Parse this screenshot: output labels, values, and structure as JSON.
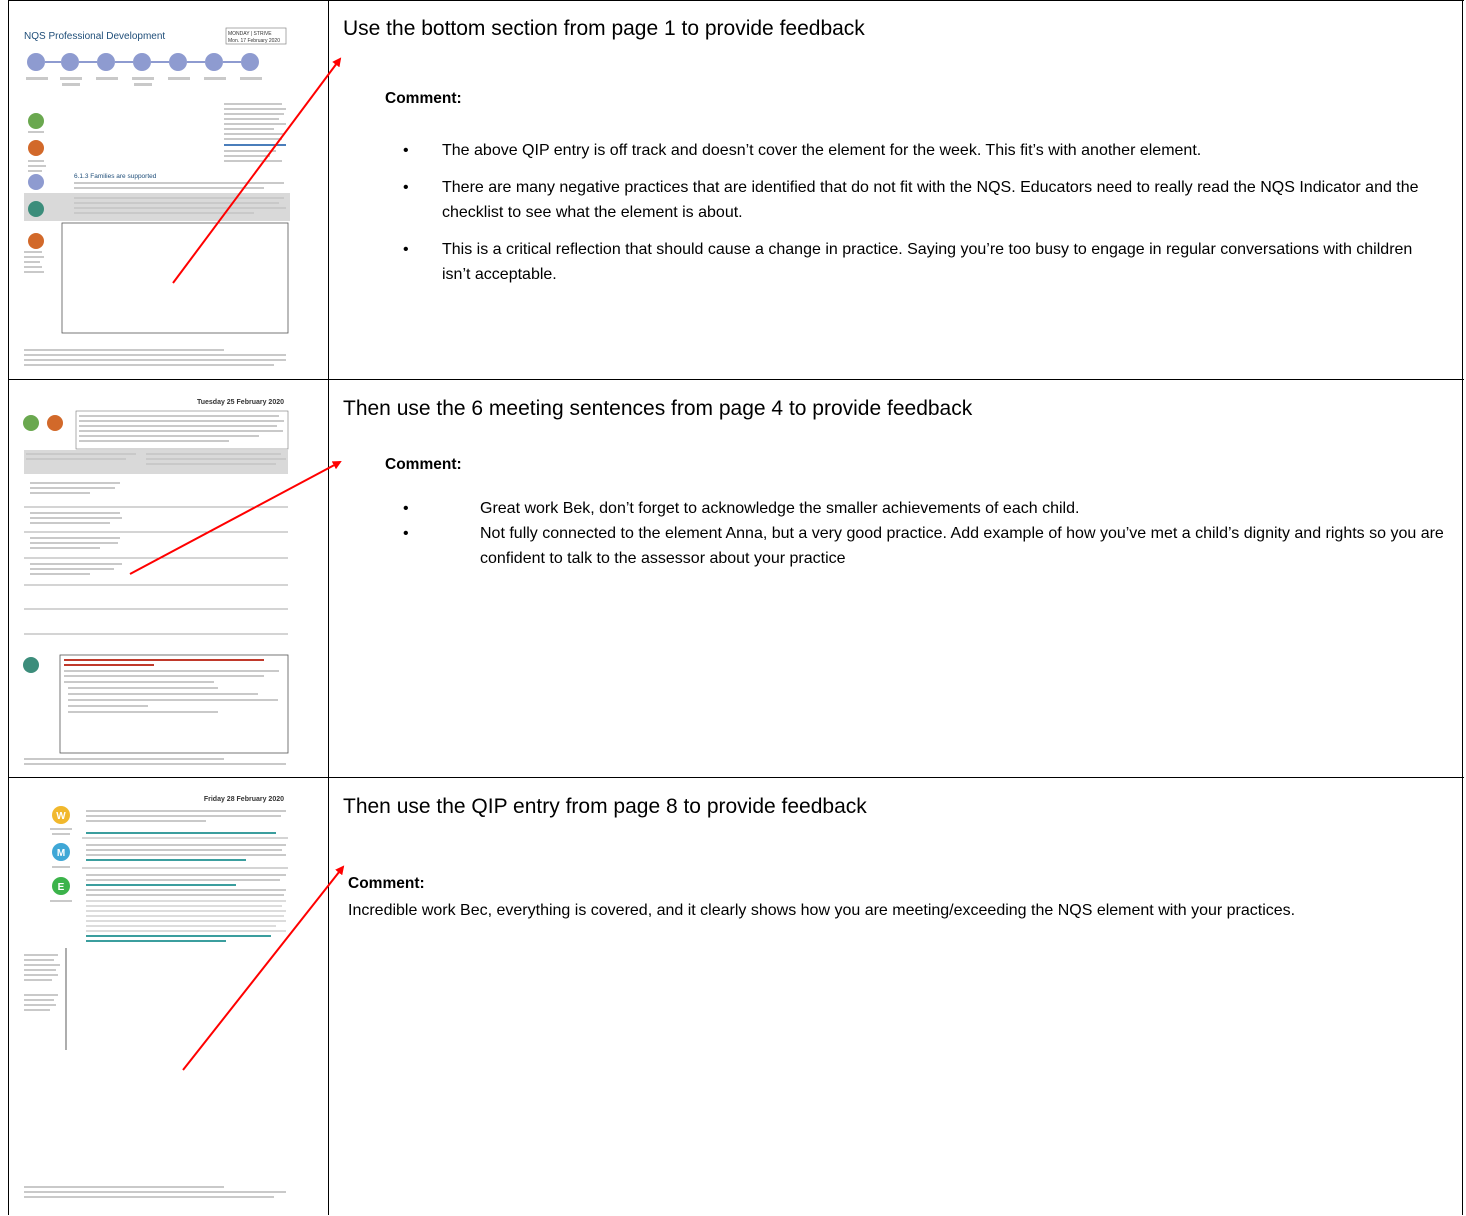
{
  "rows": [
    {
      "thumbnail": {
        "title": "NQS Professional Development",
        "date_line1": "MONDAY | STRIVE",
        "date_line2": "Mon. 17 February 2020",
        "heading": "6.1.3 Families are supported",
        "icon_colors": [
          "#6aa84f",
          "#d2692a",
          "#8e9bd0",
          "#3c8d7b",
          "#d2692a"
        ]
      },
      "heading": "Use the bottom section from page 1 to provide feedback",
      "comment_label": "Comment:",
      "bullets": [
        "The above QIP entry is off track and doesn’t cover the element for the week. This fit’s with another element.",
        "There are many negative practices that are identified that do not fit with the NQS. Educators need to really read the NQS Indicator and the checklist to see what the element is about.",
        "This is a critical reflection that should cause a change in practice. Saying you’re too busy to engage in regular conversations with children isn’t acceptable."
      ]
    },
    {
      "thumbnail": {
        "date": "Tuesday 25 February 2020"
      },
      "heading": "Then use the 6 meeting sentences from page 4 to provide feedback",
      "comment_label": "Comment:",
      "bullets": [
        "Great work Bek, don’t forget to acknowledge the smaller achievements of each child.",
        "Not fully connected to the element Anna, but a very good practice. Add example of how you’ve met a child’s dignity and rights so you are confident to talk to the assessor about your practice"
      ]
    },
    {
      "thumbnail": {
        "date": "Friday 28 February 2020",
        "badges": [
          {
            "letter": "W",
            "color": "#f1b82d"
          },
          {
            "letter": "M",
            "color": "#3fa7d6"
          },
          {
            "letter": "E",
            "color": "#3bb34a"
          }
        ]
      },
      "heading": "Then use the QIP entry from page 8 to provide feedback",
      "comment_label": "Comment:",
      "paragraph": "Incredible work Bec, everything is covered, and it clearly shows how you are meeting/exceeding the NQS element with your practices."
    }
  ],
  "colors": {
    "arrow": "#ff0000",
    "border": "#000000"
  }
}
